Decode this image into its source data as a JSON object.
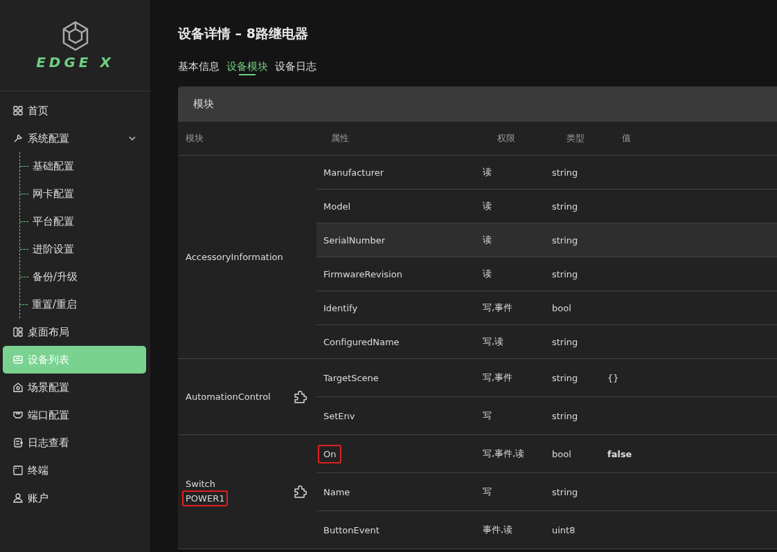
{
  "logo": {
    "text": "EDGE X"
  },
  "sidebar": {
    "items": [
      {
        "label": "首页",
        "selected": false
      },
      {
        "label": "系统配置",
        "selected": false,
        "expanded": true,
        "children": [
          {
            "label": "基础配置"
          },
          {
            "label": "网卡配置"
          },
          {
            "label": "平台配置"
          },
          {
            "label": "进阶设置"
          },
          {
            "label": "备份/升级"
          },
          {
            "label": "重置/重启"
          }
        ]
      },
      {
        "label": "桌面布局",
        "selected": false
      },
      {
        "label": "设备列表",
        "selected": true
      },
      {
        "label": "场景配置",
        "selected": false
      },
      {
        "label": "端口配置",
        "selected": false
      },
      {
        "label": "日志查看",
        "selected": false
      },
      {
        "label": "终端",
        "selected": false
      },
      {
        "label": "账户",
        "selected": false
      }
    ]
  },
  "page_title": "设备详情 – 8路继电器",
  "tabs": [
    {
      "label": "基本信息",
      "selected": false
    },
    {
      "label": "设备模块",
      "selected": true
    },
    {
      "label": "设备日志",
      "selected": false
    }
  ],
  "panel": {
    "title": "模块",
    "table": {
      "columns": [
        "模块",
        "属性",
        "权限",
        "类型",
        "值"
      ],
      "groups": [
        {
          "module": "AccessoryInformation",
          "icon": false,
          "rows": [
            {
              "property": "Manufacturer",
              "permission": "读",
              "type": "string",
              "hovered": false,
              "marked": false
            },
            {
              "property": "Model",
              "permission": "读",
              "type": "string",
              "hovered": false,
              "marked": false
            },
            {
              "property": "SerialNumber",
              "permission": "读",
              "type": "string",
              "hovered": true,
              "marked": false
            },
            {
              "property": "FirmwareRevision",
              "permission": "读",
              "type": "string",
              "hovered": false,
              "marked": false
            },
            {
              "property": "Identify",
              "permission": "写,事件",
              "type": "bool",
              "hovered": false,
              "marked": false
            },
            {
              "property": "ConfiguredName",
              "permission": "写,读",
              "type": "string",
              "hovered": false,
              "marked": false
            }
          ]
        },
        {
          "module": "AutomationControl",
          "icon": true,
          "rows": [
            {
              "property": "TargetScene",
              "permission": "写,事件",
              "type": "string",
              "value": "{}",
              "hovered": false,
              "marked": false
            },
            {
              "property": "SetEnv",
              "permission": "写",
              "type": "string",
              "hovered": false,
              "marked": false
            }
          ]
        },
        {
          "module": "Switch",
          "subtitle": {
            "text": "POWER1",
            "marked": true
          },
          "icon": true,
          "rows": [
            {
              "property": "On",
              "permission": "写,事件,读",
              "type": "bool",
              "value": "false",
              "hovered": false,
              "marked": true
            },
            {
              "property": "Name",
              "permission": "写",
              "type": "string",
              "hovered": false,
              "marked": false
            },
            {
              "property": "ButtonEvent",
              "permission": "事件,读",
              "type": "uint8",
              "hovered": false,
              "marked": false
            }
          ]
        }
      ]
    }
  }
}
